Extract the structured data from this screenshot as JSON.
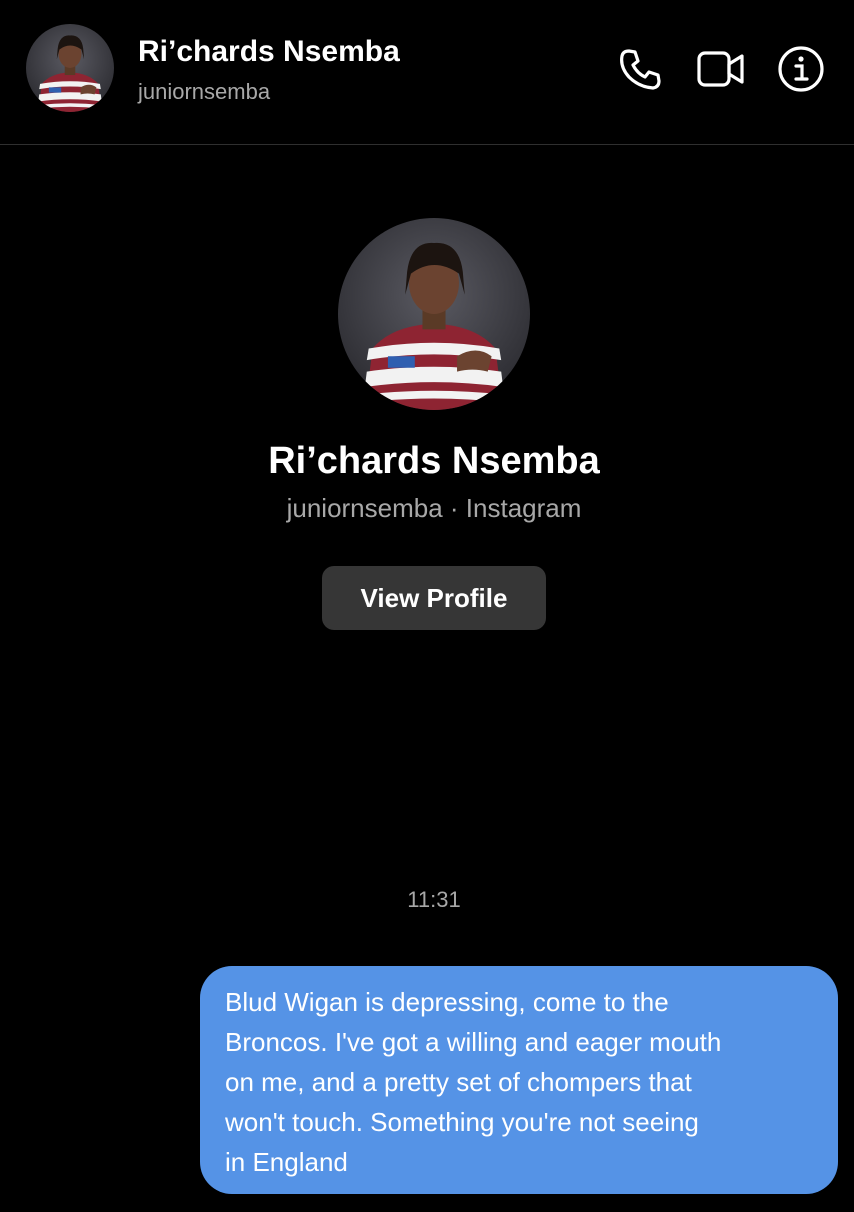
{
  "header": {
    "name": "Ri’chards Nsemba",
    "username": "juniornsemba",
    "icons": [
      "phone-icon",
      "video-camera-icon",
      "info-icon"
    ]
  },
  "profile": {
    "name": "Ri’chards Nsemba",
    "subtitle": "juniornsemba · Instagram",
    "view_profile_label": "View Profile"
  },
  "conversation": {
    "timestamp": "11:31",
    "messages": [
      {
        "sender": "me",
        "lines": [
          "Blud Wigan is depressing, come to the",
          "Broncos. I've got a willing and eager mouth",
          "on me, and a pretty set of chompers that",
          "won't touch. Something you're not seeing",
          "in England"
        ]
      }
    ]
  },
  "colors": {
    "background": "#000000",
    "outgoing_bubble": "#5593e6",
    "button_background": "#363636",
    "secondary_text": "#a8a8a8"
  }
}
